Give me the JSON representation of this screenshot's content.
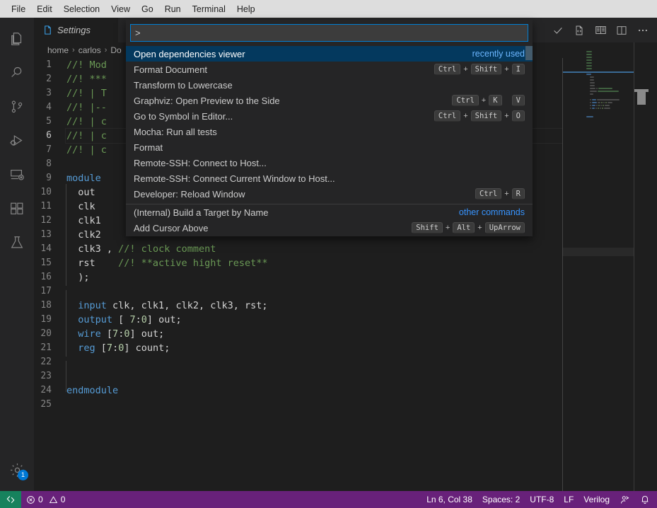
{
  "menubar": {
    "items": [
      {
        "label": "File"
      },
      {
        "label": "Edit"
      },
      {
        "label": "Selection"
      },
      {
        "label": "View"
      },
      {
        "label": "Go"
      },
      {
        "label": "Run"
      },
      {
        "label": "Terminal"
      },
      {
        "label": "Help"
      }
    ]
  },
  "activitybar": {
    "items": [
      {
        "name": "explorer",
        "icon": "files-icon"
      },
      {
        "name": "search",
        "icon": "search-icon"
      },
      {
        "name": "source-control",
        "icon": "source-control-icon"
      },
      {
        "name": "run-debug",
        "icon": "run-and-debug-icon"
      },
      {
        "name": "remote-explorer",
        "icon": "remote-explorer-icon"
      },
      {
        "name": "extensions",
        "icon": "extensions-icon"
      },
      {
        "name": "testing",
        "icon": "beaker-icon"
      }
    ],
    "manage": {
      "icon": "gear-icon",
      "badge": "1"
    }
  },
  "tabs": [
    {
      "label": "Settings",
      "icon": "file-icon",
      "active": true
    }
  ],
  "editor_actions": [
    {
      "name": "check",
      "icon": "check-icon"
    },
    {
      "name": "open-source",
      "icon": "file-code-icon"
    },
    {
      "name": "open-preview",
      "icon": "book-icon"
    },
    {
      "name": "split-editor",
      "icon": "split-editor-icon"
    },
    {
      "name": "more-actions",
      "icon": "ellipsis-icon"
    }
  ],
  "breadcrumb": [
    "home",
    "carlos",
    "Do"
  ],
  "code": {
    "lines": [
      {
        "n": "1",
        "indent": 0,
        "cursor": false,
        "tokens": [
          {
            "t": "//! Mod",
            "c": "cmt"
          }
        ]
      },
      {
        "n": "2",
        "indent": 0,
        "cursor": false,
        "tokens": [
          {
            "t": "//! ***",
            "c": "cmt"
          }
        ]
      },
      {
        "n": "3",
        "indent": 0,
        "cursor": false,
        "tokens": [
          {
            "t": "//! | T",
            "c": "cmt"
          }
        ]
      },
      {
        "n": "4",
        "indent": 0,
        "cursor": false,
        "tokens": [
          {
            "t": "//! |--",
            "c": "cmt"
          }
        ]
      },
      {
        "n": "5",
        "indent": 0,
        "cursor": false,
        "tokens": [
          {
            "t": "//! | c",
            "c": "cmt"
          }
        ]
      },
      {
        "n": "6",
        "indent": 0,
        "cursor": true,
        "tokens": [
          {
            "t": "//! | c",
            "c": "cmt"
          }
        ]
      },
      {
        "n": "7",
        "indent": 0,
        "cursor": false,
        "tokens": [
          {
            "t": "//! | c",
            "c": "cmt"
          }
        ]
      },
      {
        "n": "8",
        "indent": 0,
        "cursor": false,
        "tokens": []
      },
      {
        "n": "9",
        "indent": 0,
        "cursor": false,
        "tokens": [
          {
            "t": "module",
            "c": "kw"
          }
        ]
      },
      {
        "n": "10",
        "indent": 1,
        "cursor": false,
        "tokens": [
          {
            "t": "  out",
            "c": "txt"
          }
        ]
      },
      {
        "n": "11",
        "indent": 1,
        "cursor": false,
        "tokens": [
          {
            "t": "  clk",
            "c": "txt"
          }
        ]
      },
      {
        "n": "12",
        "indent": 1,
        "cursor": false,
        "tokens": [
          {
            "t": "  clk1",
            "c": "txt"
          }
        ]
      },
      {
        "n": "13",
        "indent": 1,
        "cursor": false,
        "tokens": [
          {
            "t": "  clk2",
            "c": "txt"
          }
        ]
      },
      {
        "n": "14",
        "indent": 1,
        "cursor": false,
        "tokens": [
          {
            "t": "  clk3 ",
            "c": "txt"
          },
          {
            "t": ", ",
            "c": "txt"
          },
          {
            "t": "//! clock comment",
            "c": "cmt"
          }
        ]
      },
      {
        "n": "15",
        "indent": 1,
        "cursor": false,
        "tokens": [
          {
            "t": "  rst    ",
            "c": "txt"
          },
          {
            "t": "//! **active hight reset**",
            "c": "cmt"
          }
        ]
      },
      {
        "n": "16",
        "indent": 1,
        "cursor": false,
        "tokens": [
          {
            "t": "  );",
            "c": "txt"
          }
        ]
      },
      {
        "n": "17",
        "indent": 1,
        "cursor": false,
        "tokens": []
      },
      {
        "n": "18",
        "indent": 1,
        "cursor": false,
        "tokens": [
          {
            "t": "  ",
            "c": "txt"
          },
          {
            "t": "input",
            "c": "kw"
          },
          {
            "t": " clk, clk1, clk2, clk3, rst;",
            "c": "txt"
          }
        ]
      },
      {
        "n": "19",
        "indent": 1,
        "cursor": false,
        "tokens": [
          {
            "t": "  ",
            "c": "txt"
          },
          {
            "t": "output",
            "c": "kw"
          },
          {
            "t": " [ ",
            "c": "txt"
          },
          {
            "t": "7",
            "c": "num"
          },
          {
            "t": ":",
            "c": "txt"
          },
          {
            "t": "0",
            "c": "num"
          },
          {
            "t": "] out;",
            "c": "txt"
          }
        ]
      },
      {
        "n": "20",
        "indent": 1,
        "cursor": false,
        "tokens": [
          {
            "t": "  ",
            "c": "txt"
          },
          {
            "t": "wire",
            "c": "kw"
          },
          {
            "t": " [",
            "c": "txt"
          },
          {
            "t": "7",
            "c": "num"
          },
          {
            "t": ":",
            "c": "txt"
          },
          {
            "t": "0",
            "c": "num"
          },
          {
            "t": "] out;",
            "c": "txt"
          }
        ]
      },
      {
        "n": "21",
        "indent": 1,
        "cursor": false,
        "tokens": [
          {
            "t": "  ",
            "c": "txt"
          },
          {
            "t": "reg",
            "c": "kw"
          },
          {
            "t": " [",
            "c": "txt"
          },
          {
            "t": "7",
            "c": "num"
          },
          {
            "t": ":",
            "c": "txt"
          },
          {
            "t": "0",
            "c": "num"
          },
          {
            "t": "] count;",
            "c": "txt"
          }
        ]
      },
      {
        "n": "22",
        "indent": 1,
        "cursor": false,
        "tokens": []
      },
      {
        "n": "23",
        "indent": 1,
        "cursor": false,
        "tokens": []
      },
      {
        "n": "24",
        "indent": 0,
        "cursor": false,
        "tokens": [
          {
            "t": "endmodule",
            "c": "kw"
          }
        ]
      },
      {
        "n": "25",
        "indent": 0,
        "cursor": false,
        "tokens": []
      }
    ]
  },
  "palette": {
    "input_value": ">",
    "input_placeholder": "",
    "items": [
      {
        "label": "Open dependencies viewer",
        "selected": true,
        "note": "recently used",
        "keys": []
      },
      {
        "label": "Format Document",
        "selected": false,
        "note": "",
        "keys": [
          "Ctrl",
          "+",
          "Shift",
          "+",
          "I"
        ]
      },
      {
        "label": "Transform to Lowercase",
        "selected": false,
        "note": "",
        "keys": []
      },
      {
        "label": "Graphviz: Open Preview to the Side",
        "selected": false,
        "note": "",
        "keys": [
          "Ctrl",
          "+",
          "K",
          " ",
          "V"
        ]
      },
      {
        "label": "Go to Symbol in Editor...",
        "selected": false,
        "note": "",
        "keys": [
          "Ctrl",
          "+",
          "Shift",
          "+",
          "O"
        ]
      },
      {
        "label": "Mocha: Run all tests",
        "selected": false,
        "note": "",
        "keys": []
      },
      {
        "label": "Format",
        "selected": false,
        "note": "",
        "keys": []
      },
      {
        "label": "Remote-SSH: Connect to Host...",
        "selected": false,
        "note": "",
        "keys": []
      },
      {
        "label": "Remote-SSH: Connect Current Window to Host...",
        "selected": false,
        "note": "",
        "keys": []
      },
      {
        "label": "Developer: Reload Window",
        "selected": false,
        "note": "",
        "keys": [
          "Ctrl",
          "+",
          "R"
        ],
        "separator_after": true
      },
      {
        "label": "(Internal) Build a Target by Name",
        "selected": false,
        "note": "other commands",
        "keys": []
      },
      {
        "label": "Add Cursor Above",
        "selected": false,
        "note": "",
        "keys": [
          "Shift",
          "+",
          "Alt",
          "+",
          "UpArrow"
        ]
      }
    ]
  },
  "statusbar": {
    "remote_icon": "remote-indicator-icon",
    "problems": {
      "errors": "0",
      "warnings": "0"
    },
    "cursor_position": "Ln 6, Col 38",
    "indentation": "Spaces: 2",
    "encoding": "UTF-8",
    "eol": "LF",
    "language": "Verilog",
    "feedback_icon": "feedback-icon",
    "bell_icon": "bell-icon"
  },
  "colors": {
    "menubar_bg": "#dddddd",
    "activitybar_bg": "#252526",
    "editor_bg": "#1e1e1e",
    "palette_bg": "#252526",
    "palette_selected_bg": "#04395e",
    "statusbar_bg": "#68217a",
    "remote_bg": "#16825d",
    "accent_blue": "#3794ff",
    "badge_blue": "#0078d4",
    "comment_green": "#6a9955",
    "keyword_blue": "#569cd6",
    "number_green": "#b5cea8"
  }
}
